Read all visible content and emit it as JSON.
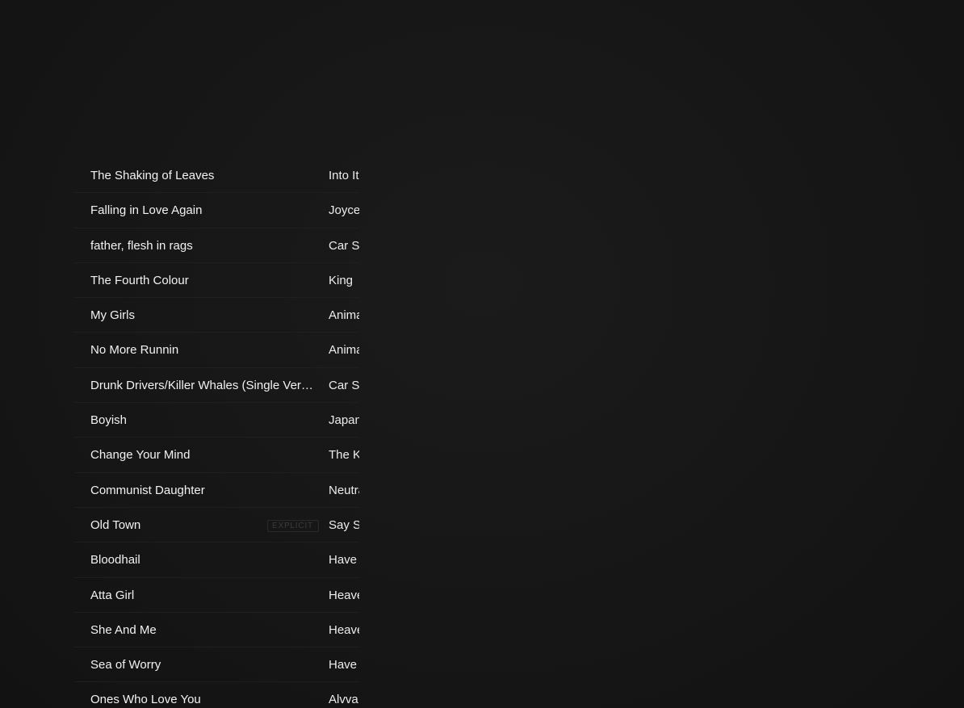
{
  "tracks": [
    {
      "title": "The Shaking of Leaves",
      "artist": "Into It",
      "explicit": ""
    },
    {
      "title": "Falling in Love Again",
      "artist": "Joyce",
      "explicit": ""
    },
    {
      "title": "father, flesh in rags",
      "artist": "Car Seat",
      "explicit": ""
    },
    {
      "title": "The Fourth Colour",
      "artist": "King",
      "explicit": ""
    },
    {
      "title": "My Girls",
      "artist": "Animal",
      "explicit": ""
    },
    {
      "title": "No More Runnin",
      "artist": "Animal",
      "explicit": ""
    },
    {
      "title": "Drunk Drivers/Killer Whales (Single Version)",
      "artist": "Car Seat",
      "explicit": ""
    },
    {
      "title": "Boyish",
      "artist": "Japan",
      "explicit": ""
    },
    {
      "title": "Change Your Mind",
      "artist": "The K",
      "explicit": ""
    },
    {
      "title": "Communist Daughter",
      "artist": "Neutral",
      "explicit": ""
    },
    {
      "title": "Old Town",
      "artist": "Say S",
      "explicit": "EXPLICIT"
    },
    {
      "title": "Bloodhail",
      "artist": "Have",
      "explicit": ""
    },
    {
      "title": "Atta Girl",
      "artist": "Heave",
      "explicit": ""
    },
    {
      "title": "She And Me",
      "artist": "Heave",
      "explicit": ""
    },
    {
      "title": "Sea of Worry",
      "artist": "Have",
      "explicit": ""
    },
    {
      "title": "Ones Who Love You",
      "artist": "Alvva",
      "explicit": ""
    }
  ]
}
